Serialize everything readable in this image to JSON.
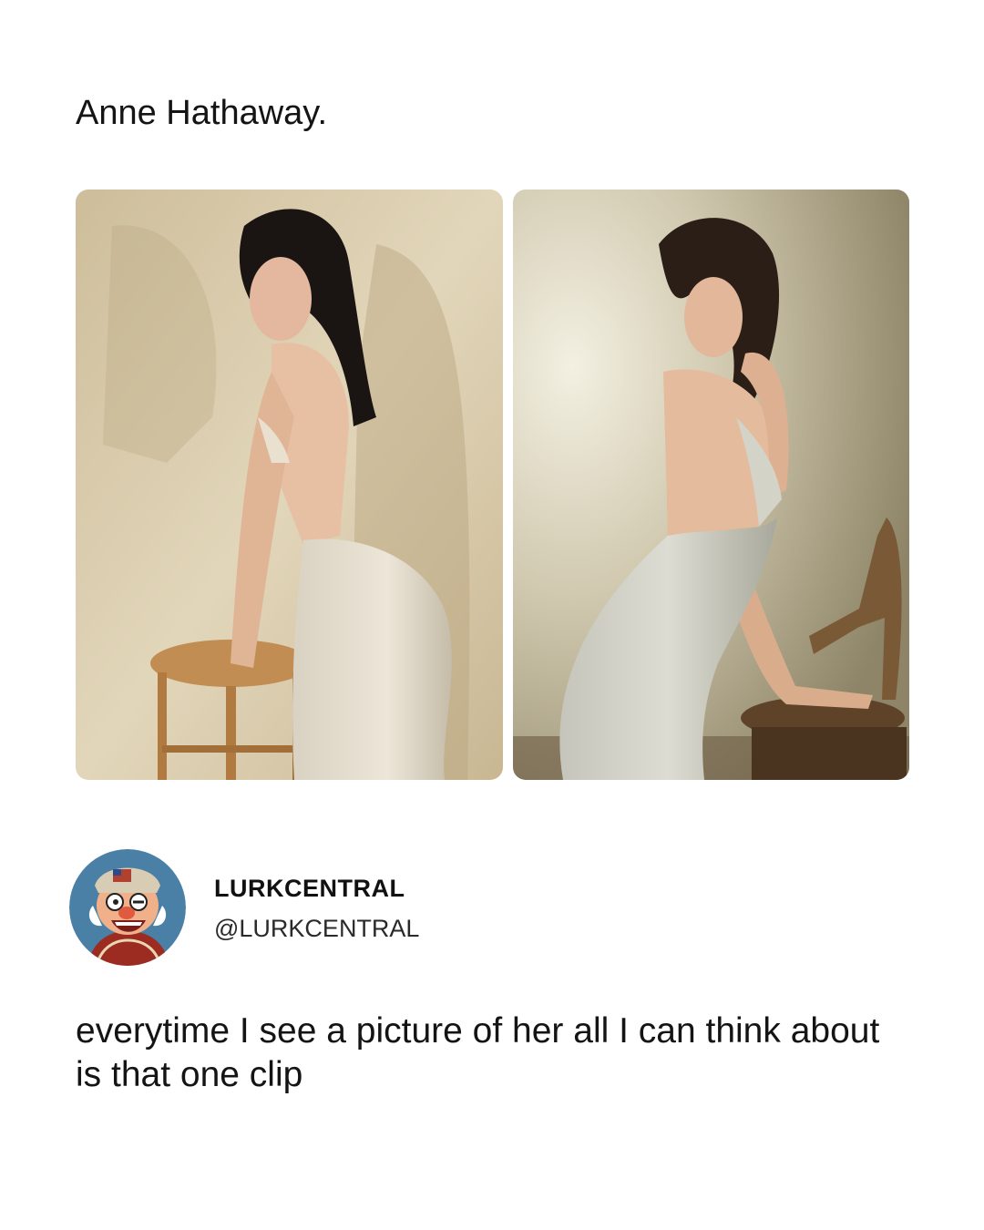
{
  "post": {
    "caption": "Anne Hathaway."
  },
  "photos": [
    {
      "description_icon": "photo-left"
    },
    {
      "description_icon": "photo-right"
    }
  ],
  "author": {
    "display_name": "LURKCENTRAL",
    "handle": "@LURKCENTRAL"
  },
  "tweet": {
    "text": "everytime I see a picture of her all I can think about is that one clip"
  },
  "colors": {
    "background": "#ffffff",
    "text": "#141414",
    "avatar_bg": "#4a7fa6"
  }
}
